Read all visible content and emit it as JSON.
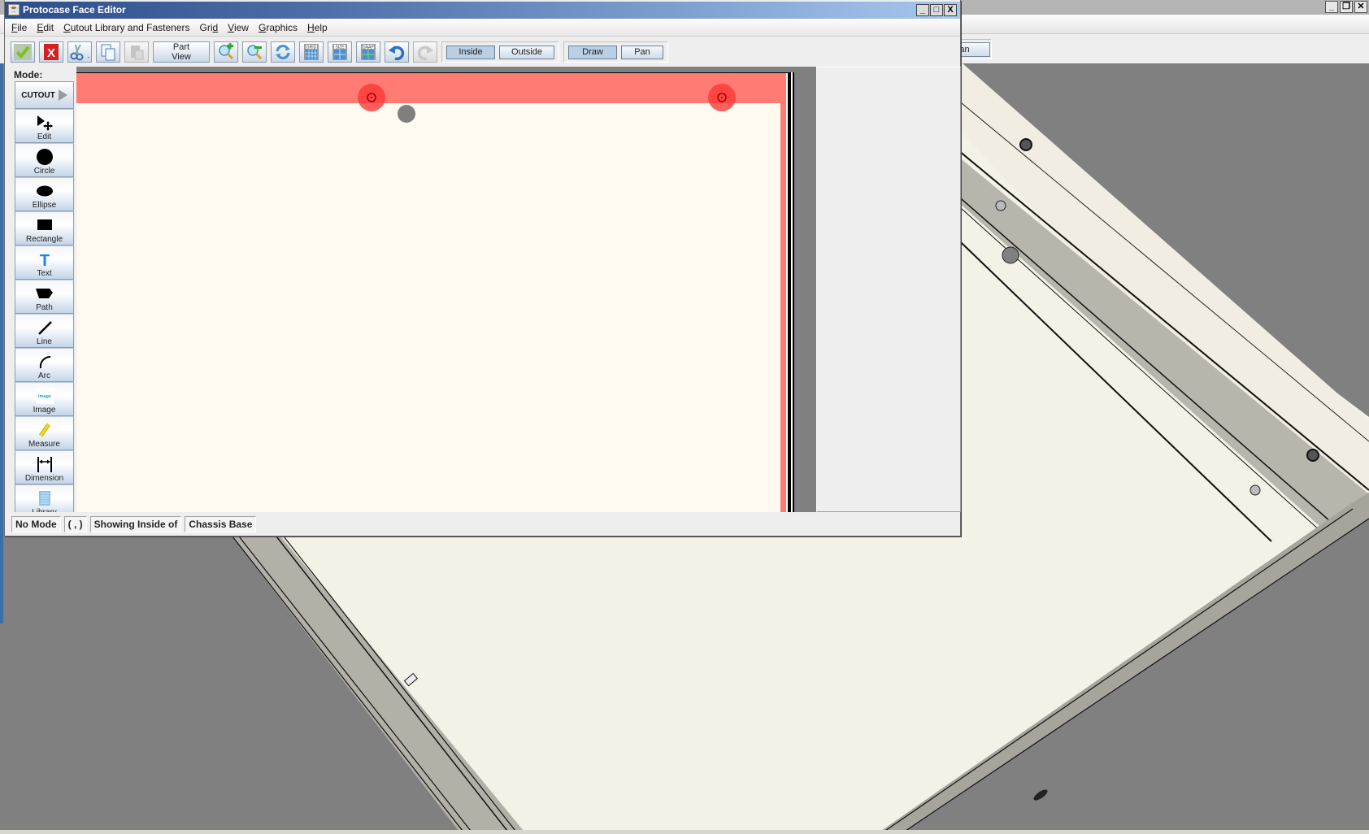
{
  "background_window": {
    "window_controls": [
      "minimize",
      "restore",
      "close"
    ],
    "toolbar": {
      "pan_label": "Pan"
    }
  },
  "window": {
    "title": "Protocase Face Editor",
    "controls": {
      "minimize": "_",
      "maximize": "□",
      "close": "X"
    }
  },
  "menu": [
    {
      "label": "File",
      "mnemonic": "F",
      "rest": "ile"
    },
    {
      "label": "Edit",
      "mnemonic": "E",
      "rest": "dit"
    },
    {
      "label": "Cutout Library and Fasteners",
      "mnemonic": "C",
      "rest": "utout Library and Fasteners"
    },
    {
      "label": "Grid",
      "pre": "Gri",
      "mnemonic": "d"
    },
    {
      "label": "View",
      "mnemonic": "V",
      "rest": "iew"
    },
    {
      "label": "Graphics",
      "mnemonic": "G",
      "rest": "raphics"
    },
    {
      "label": "Help",
      "mnemonic": "H",
      "rest": "elp"
    }
  ],
  "toolbar": {
    "buttons": [
      {
        "name": "accept",
        "icon": "checkmark-icon"
      },
      {
        "name": "cancel",
        "icon": "red-x-icon"
      },
      {
        "name": "cut",
        "icon": "scissors-icon"
      },
      {
        "name": "copy",
        "icon": "copy-icon"
      },
      {
        "name": "paste",
        "icon": "paste-icon",
        "disabled": true
      },
      {
        "name": "part-view",
        "label_line1": "Part",
        "label_line2": "View"
      },
      {
        "name": "zoom-in",
        "icon": "zoom-in-icon"
      },
      {
        "name": "zoom-out",
        "icon": "zoom-out-icon"
      },
      {
        "name": "refresh",
        "icon": "refresh-icon"
      },
      {
        "name": "grid",
        "icon": "grid-icon",
        "badge": "GRID"
      },
      {
        "name": "size",
        "icon": "size-icon",
        "badge": "SIZE"
      },
      {
        "name": "snap",
        "icon": "snap-icon",
        "badge": "SNAP"
      },
      {
        "name": "undo",
        "icon": "undo-icon"
      },
      {
        "name": "redo",
        "icon": "redo-icon",
        "disabled": true
      }
    ],
    "side_toggle": {
      "inside": "Inside",
      "outside": "Outside",
      "selected": "Inside"
    },
    "mode_toggle": {
      "draw": "Draw",
      "pan": "Pan",
      "selected": "Draw"
    }
  },
  "sidebar": {
    "mode_label": "Mode:",
    "mode_value": "CUTOUT",
    "tools": [
      {
        "label": "Edit",
        "icon": "edit-pointer-icon"
      },
      {
        "label": "Circle",
        "icon": "circle-icon"
      },
      {
        "label": "Ellipse",
        "icon": "ellipse-icon"
      },
      {
        "label": "Rectangle",
        "icon": "rectangle-icon"
      },
      {
        "label": "Text",
        "icon": "text-icon"
      },
      {
        "label": "Path",
        "icon": "path-icon"
      },
      {
        "label": "Line",
        "icon": "line-icon"
      },
      {
        "label": "Arc",
        "icon": "arc-icon"
      },
      {
        "label": "Image",
        "icon": "image-icon",
        "icon_text": "Image"
      },
      {
        "label": "Measure",
        "icon": "measure-icon"
      },
      {
        "label": "Dimension",
        "icon": "dimension-icon"
      },
      {
        "label": "Library",
        "icon": "library-icon"
      }
    ]
  },
  "canvas": {
    "colors": {
      "face": "#fffaf0",
      "flange_band": "#ff7b74",
      "fastener": "#ff3b3b",
      "selected_hole": "#7f7f7f",
      "background": "#808080"
    },
    "fasteners": 2,
    "holes": 1
  },
  "status": {
    "mode": "No Mode",
    "coords": "( , )",
    "showing": "Showing Inside of",
    "part": "Chassis Base"
  }
}
